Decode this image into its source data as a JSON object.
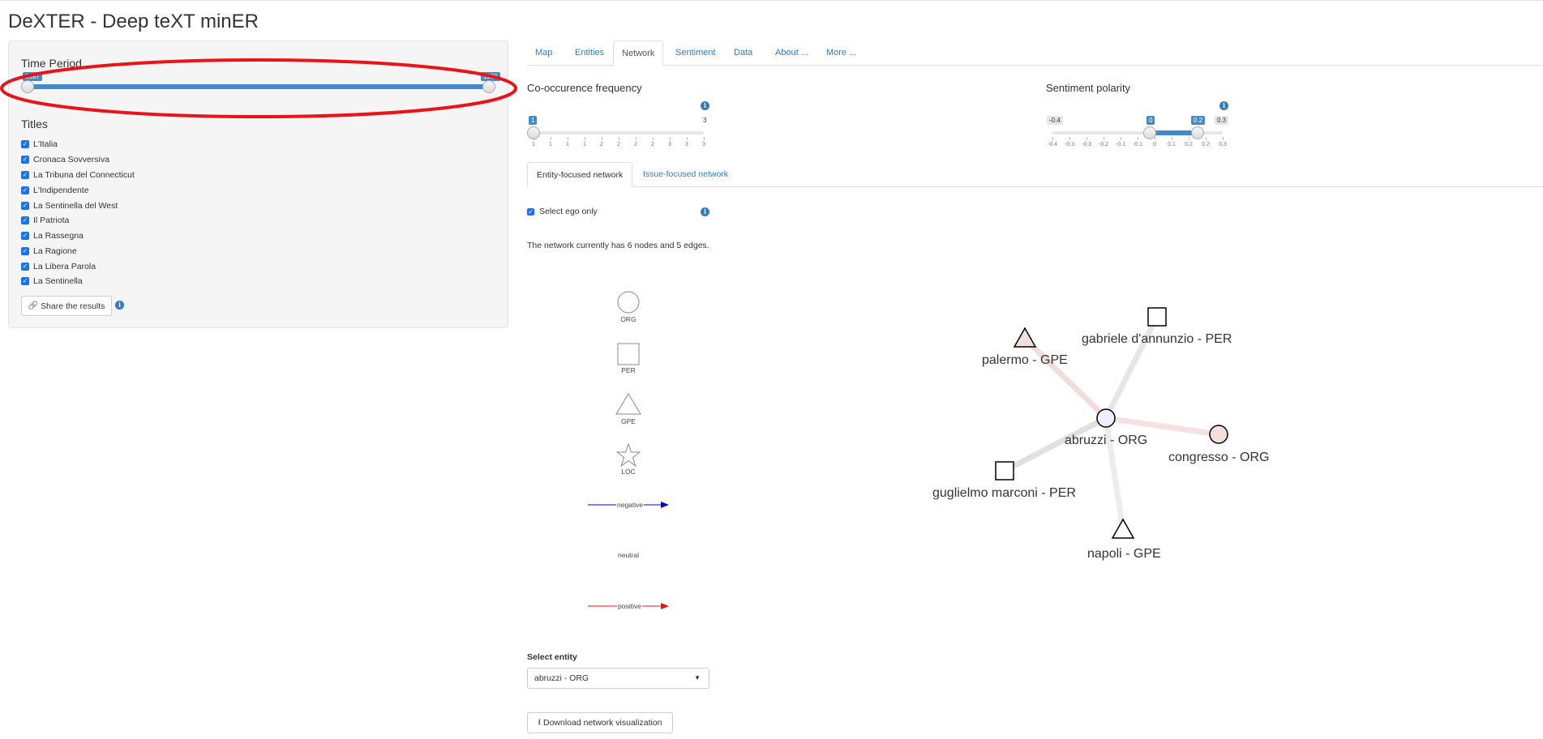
{
  "app": {
    "title": "DeXTER - Deep teXT minER"
  },
  "sidebar": {
    "time_period_label": "Time Period",
    "time_range": {
      "min_label": "1897",
      "max_label": "1936",
      "selected_start": "1897",
      "selected_end": "1936"
    },
    "titles_label": "Titles",
    "titles": [
      {
        "label": "L'Italia",
        "checked": true
      },
      {
        "label": "Cronaca Sovversiva",
        "checked": true
      },
      {
        "label": "La Tribuna del Connecticut",
        "checked": true
      },
      {
        "label": "L'Indipendente",
        "checked": true
      },
      {
        "label": "La Sentinella del West",
        "checked": true
      },
      {
        "label": "Il Patriota",
        "checked": true
      },
      {
        "label": "La Rassegna",
        "checked": true
      },
      {
        "label": "La Ragione",
        "checked": true
      },
      {
        "label": "La Libera Parola",
        "checked": true
      },
      {
        "label": "La Sentinella",
        "checked": true
      }
    ],
    "share_button": "Share the results",
    "annotation_color": "#e8141a"
  },
  "tabs": [
    {
      "label": "Map",
      "active": false
    },
    {
      "label": "Entities",
      "active": false
    },
    {
      "label": "Network",
      "active": true
    },
    {
      "label": "Sentiment",
      "active": false
    },
    {
      "label": "Data",
      "active": false
    },
    {
      "label": "About ...",
      "active": false
    },
    {
      "label": "More ...",
      "active": false
    }
  ],
  "cooccurrence": {
    "label": "Co-occurence frequency",
    "value": "1",
    "max": "3",
    "ticks": [
      "1",
      "1",
      "1",
      "1",
      "2",
      "2",
      "2",
      "2",
      "3",
      "3",
      "3"
    ]
  },
  "sentiment": {
    "label": "Sentiment polarity",
    "min": "-0.4",
    "from": "0",
    "to": "0.2",
    "max": "0.3",
    "ticks": [
      "-0.4",
      "-0.3",
      "-0.3",
      "-0.2",
      "-0.1",
      "-0.1",
      "0",
      "0.1",
      "0.2",
      "0.2",
      "0.3"
    ]
  },
  "subtabs": [
    {
      "label": "Entity-focused network",
      "active": true
    },
    {
      "label": "Issue-focused network",
      "active": false
    }
  ],
  "ego_only": {
    "label": "Select ego only",
    "checked": true
  },
  "network_summary": "The network currently has 6 nodes and 5 edges.",
  "legend": {
    "shapes": [
      {
        "label": "ORG",
        "shape": "circle"
      },
      {
        "label": "PER",
        "shape": "square"
      },
      {
        "label": "GPE",
        "shape": "triangle"
      },
      {
        "label": "LOC",
        "shape": "star"
      }
    ],
    "edges": [
      {
        "label": "negative",
        "color": "#0000cc"
      },
      {
        "label": "neutral",
        "color": "#ffffff"
      },
      {
        "label": "positive",
        "color": "#e8141a"
      }
    ]
  },
  "network": {
    "center": {
      "label": "abruzzi - ORG",
      "shape": "circle"
    },
    "nodes": [
      {
        "label": "gabriele d'annunzio - PER",
        "shape": "square"
      },
      {
        "label": "palermo - GPE",
        "shape": "triangle"
      },
      {
        "label": "congresso - ORG",
        "shape": "circle"
      },
      {
        "label": "guglielmo marconi - PER",
        "shape": "square"
      },
      {
        "label": "napoli - GPE",
        "shape": "triangle"
      }
    ]
  },
  "select_entity": {
    "label": "Select entity",
    "value": "abruzzi - ORG"
  },
  "download_button": "Download network visualization"
}
